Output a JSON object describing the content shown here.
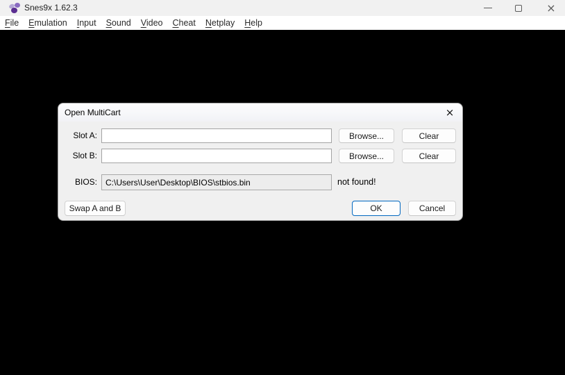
{
  "window": {
    "title": "Snes9x 1.62.3"
  },
  "icons": {
    "window_close": "×",
    "dialog_close": "×"
  },
  "menu": {
    "items": [
      {
        "mnemonic": "F",
        "rest": "ile"
      },
      {
        "mnemonic": "E",
        "rest": "mulation"
      },
      {
        "mnemonic": "I",
        "rest": "nput"
      },
      {
        "mnemonic": "S",
        "rest": "ound"
      },
      {
        "mnemonic": "V",
        "rest": "ideo"
      },
      {
        "mnemonic": "C",
        "rest": "heat"
      },
      {
        "mnemonic": "N",
        "rest": "etplay"
      },
      {
        "mnemonic": "H",
        "rest": "elp"
      }
    ]
  },
  "dialog": {
    "title": "Open MultiCart",
    "slot_a": {
      "label": "Slot A:",
      "value": "",
      "browse_label": "Browse...",
      "clear_label": "Clear"
    },
    "slot_b": {
      "label": "Slot B:",
      "value": "",
      "browse_label": "Browse...",
      "clear_label": "Clear"
    },
    "bios": {
      "label": "BIOS:",
      "value": "C:\\Users\\User\\Desktop\\BIOS\\stbios.bin",
      "status": "not found!"
    },
    "swap_label": "Swap A and B",
    "ok_label": "OK",
    "cancel_label": "Cancel"
  },
  "colors": {
    "accent": "#0067c0",
    "titlebar_bg": "#f1f1f1",
    "menubar_bg": "#ffffff",
    "viewport_bg": "#000000",
    "dialog_bg": "#f0f0f0"
  }
}
